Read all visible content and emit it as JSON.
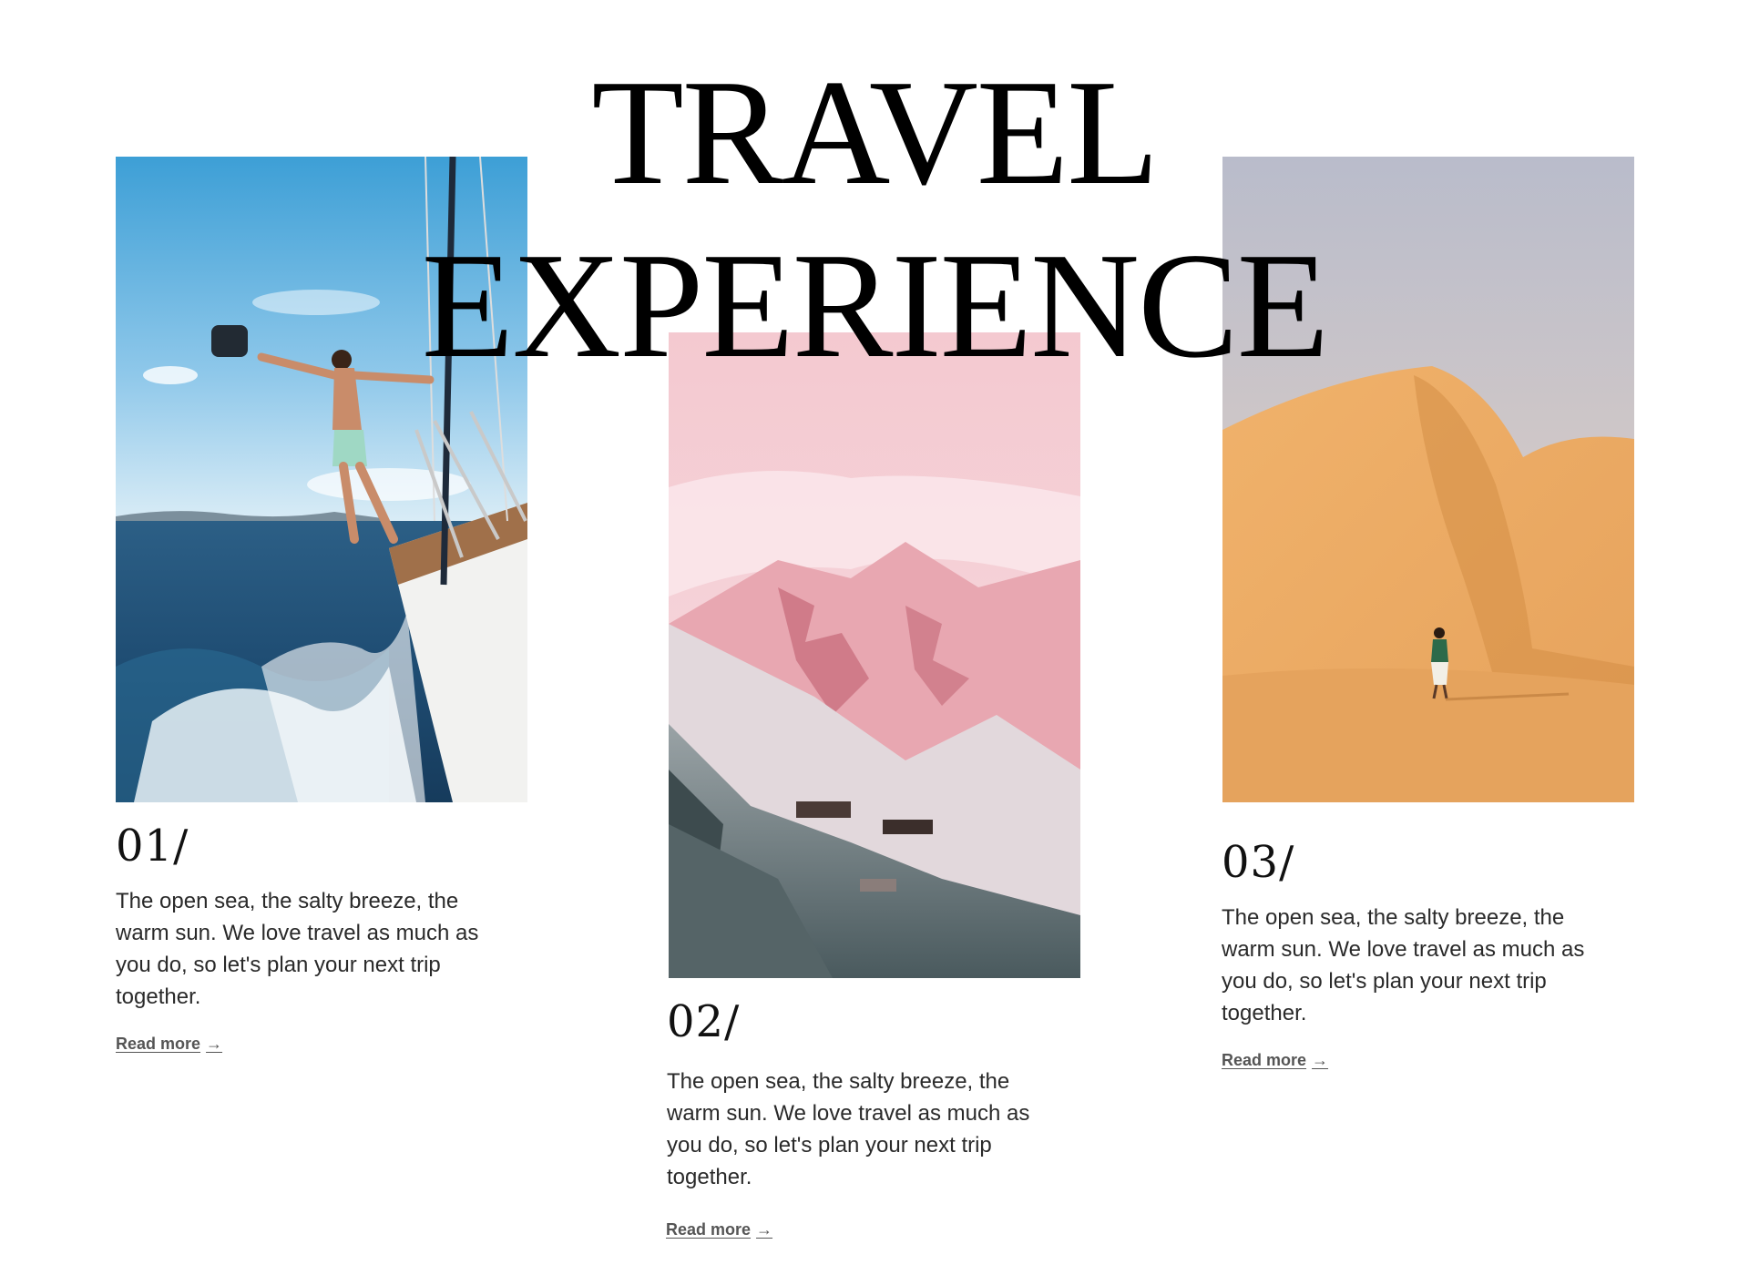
{
  "title": {
    "line1": "TRAVEL",
    "line2": "EXPERIENCE"
  },
  "cards": [
    {
      "number": "01/",
      "description": "The open sea, the salty breeze, the warm sun. We love travel as much as you do, so let's plan your next trip together.",
      "link_label": "Read more",
      "link_arrow": "→"
    },
    {
      "number": "02/",
      "description": "The open sea, the salty breeze, the warm sun. We love travel as much as you do, so let's plan your next trip together.",
      "link_label": "Read more",
      "link_arrow": "→"
    },
    {
      "number": "03/",
      "description": "The open sea, the salty breeze, the warm sun. We love travel as much as you do, so let's plan your next trip together.",
      "link_label": "Read more",
      "link_arrow": "→"
    }
  ],
  "colors": {
    "background": "#ffffff",
    "text": "#111111",
    "link": "#555555"
  }
}
